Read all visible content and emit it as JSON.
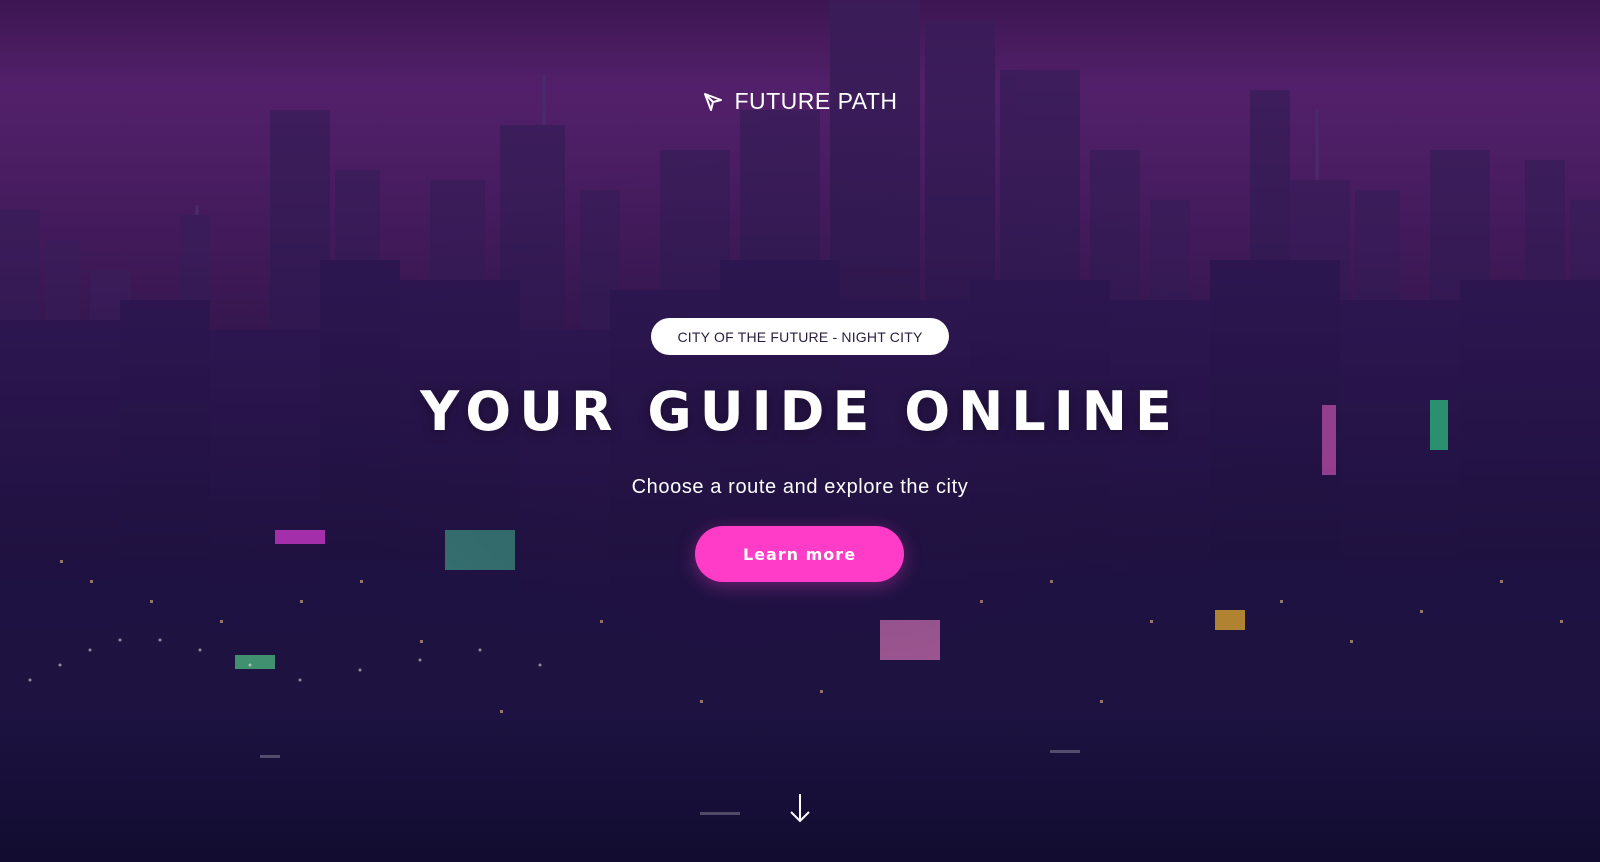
{
  "brand": {
    "name": "FUTURE PATH",
    "icon": "compass-arrow-icon"
  },
  "hero": {
    "tag": "CITY OF THE FUTURE - NIGHT CITY",
    "title": "YOUR GUIDE ONLINE",
    "subtitle": "Choose a route and explore the city",
    "cta_label": "Learn more",
    "scroll_icon": "arrow-down-icon"
  },
  "colors": {
    "accent": "#ff3cc7",
    "background": "#2e1448",
    "text": "#ffffff"
  }
}
